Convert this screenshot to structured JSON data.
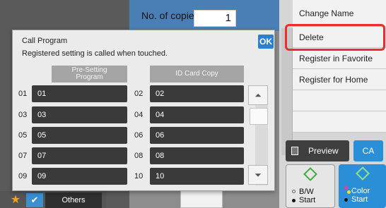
{
  "header": {
    "copies_label": "No. of copies",
    "copies_value": "1"
  },
  "right_menu": {
    "items": [
      "Change Name",
      "Delete",
      "Register in Favorite",
      "Register for Home"
    ]
  },
  "actions": {
    "preview": "Preview",
    "ca": "CA",
    "bw_start": "B/W\nStart",
    "color_start": "Color\nStart"
  },
  "bottom": {
    "others": "Others"
  },
  "dialog": {
    "title": "Call Program",
    "description": "Registered setting is called when touched.",
    "ok_label": "OK",
    "columns": [
      "Pre-Setting Program",
      "ID Card Copy"
    ],
    "rows": [
      {
        "left_num": "01",
        "left_label": "01",
        "right_num": "02",
        "right_label": "02"
      },
      {
        "left_num": "03",
        "left_label": "03",
        "right_num": "04",
        "right_label": "04"
      },
      {
        "left_num": "05",
        "left_label": "05",
        "right_num": "06",
        "right_label": "06"
      },
      {
        "left_num": "07",
        "left_label": "07",
        "right_num": "08",
        "right_label": "08"
      },
      {
        "left_num": "09",
        "left_label": "09",
        "right_num": "10",
        "right_label": "10"
      }
    ]
  },
  "colors": {
    "accent": "#2b7fd4",
    "highlight": "#e53030",
    "button_dark": "#3a3a3a"
  },
  "icons": {
    "star": "star-icon",
    "check": "checkmark-icon",
    "scroll_up": "double-chevron-up-icon",
    "scroll_down": "double-chevron-down-icon"
  }
}
